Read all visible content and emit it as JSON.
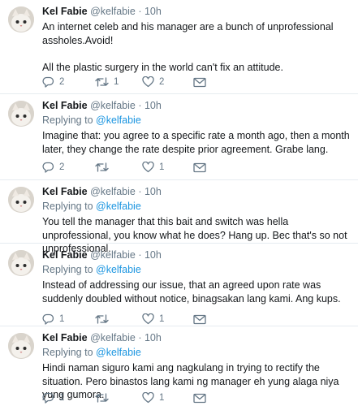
{
  "tweets": [
    {
      "name": "Kel Fabie",
      "handle": "@kelfabie",
      "sep": "·",
      "time": "10h",
      "replying_prefix": "",
      "replying_to": "",
      "text": "An internet celeb and his manager are a bunch of unprofessional assholes.Avoid!\n\nAll the plastic surgery in the world can't fix an attitude.",
      "replies": "2",
      "retweets": "1",
      "likes": "2"
    },
    {
      "name": "Kel Fabie",
      "handle": "@kelfabie",
      "sep": "·",
      "time": "10h",
      "replying_prefix": "Replying to ",
      "replying_to": "@kelfabie",
      "text": "Imagine that: you agree to a specific rate a month ago, then a month later, they change the rate despite prior agreement. Grabe lang.",
      "replies": "2",
      "retweets": "",
      "likes": "1"
    },
    {
      "name": "Kel Fabie",
      "handle": "@kelfabie",
      "sep": "·",
      "time": "10h",
      "replying_prefix": "Replying to ",
      "replying_to": "@kelfabie",
      "text": "You tell the manager that this bait and switch was hella unprofessional, you know what he does? Hang up. Bec that's so not unprofessional.",
      "replies": "",
      "retweets": "",
      "likes": ""
    },
    {
      "name": "Kel Fabie",
      "handle": "@kelfabie",
      "sep": "·",
      "time": "10h",
      "replying_prefix": "Replying to ",
      "replying_to": "@kelfabie",
      "text": "Instead of addressing our issue, that an agreed upon rate was suddenly doubled without notice, binagsakan lang kami. Ang kups.",
      "replies": "1",
      "retweets": "",
      "likes": "1"
    },
    {
      "name": "Kel Fabie",
      "handle": "@kelfabie",
      "sep": "·",
      "time": "10h",
      "replying_prefix": "Replying to ",
      "replying_to": "@kelfabie",
      "text": "Hindi naman siguro kami ang nagkulang in trying to rectify the situation. Pero binastos lang kami ng manager eh yung alaga niya yung gumora.",
      "replies": "1",
      "retweets": "",
      "likes": "1"
    }
  ],
  "icons": {
    "reply": "reply-icon",
    "retweet": "retweet-icon",
    "like": "heart-icon",
    "message": "envelope-icon",
    "avatar": "cat-avatar"
  },
  "colors": {
    "text": "#14171a",
    "muted": "#657786",
    "link": "#1b95e0",
    "divider": "#e6ecf0"
  }
}
